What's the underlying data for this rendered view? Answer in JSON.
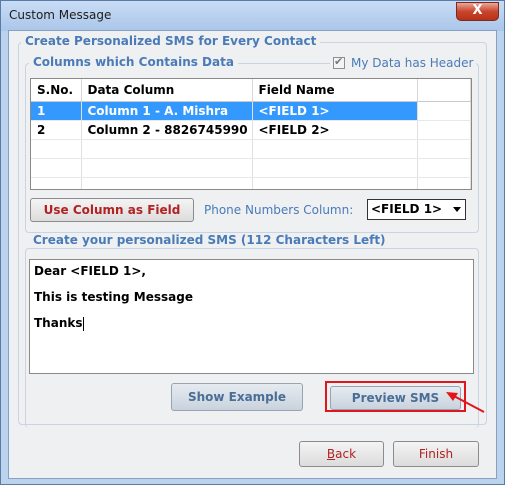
{
  "window": {
    "title": "Custom Message",
    "close_glyph": "X"
  },
  "main_group": {
    "legend": "Create Personalized SMS for Every Contact"
  },
  "columns_group": {
    "legend": "Columns which Contains Data",
    "header_checkbox": {
      "label": "My Data has Header",
      "checked": true
    }
  },
  "table": {
    "headers": [
      "S.No.",
      "Data Column",
      "Field Name"
    ],
    "rows": [
      {
        "sno": "1",
        "column": "Column 1 - A. Mishra",
        "field": "<FIELD 1>",
        "selected": true
      },
      {
        "sno": "2",
        "column": "Column 2 - 8826745990",
        "field": "<FIELD 2>",
        "selected": false
      }
    ]
  },
  "use_column_button": "Use Column as Field",
  "phone_column": {
    "label": "Phone Numbers Column:",
    "selected": "<FIELD 1>"
  },
  "sms_group": {
    "legend": "Create your personalized SMS (112 Characters Left)"
  },
  "message_lines": [
    "Dear <FIELD 1>,",
    "This is testing Message",
    "Thanks"
  ],
  "show_example_button": "Show Example",
  "preview_sms_button": "Preview SMS",
  "nav": {
    "back_first": "B",
    "back_rest": "ack",
    "finish": "Finish"
  },
  "colors": {
    "accent": "#4a7bb7",
    "highlight": "#e0161c",
    "selection": "#3399ff"
  }
}
